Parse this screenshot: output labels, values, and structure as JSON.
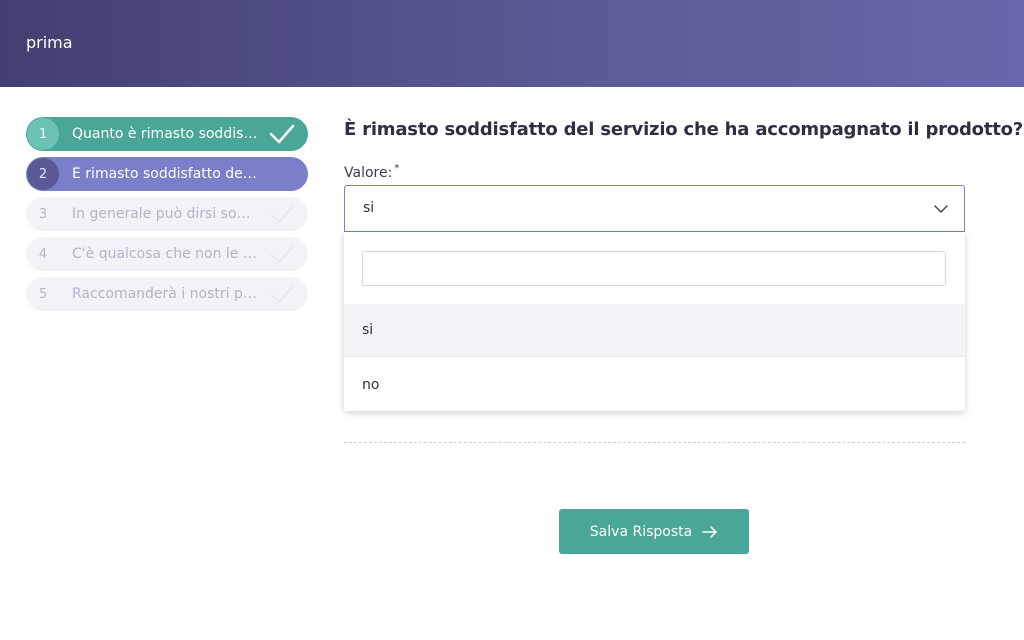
{
  "header": {
    "title": "prima"
  },
  "steps": [
    {
      "number": "1",
      "label": "Quanto è rimasto soddisfa…",
      "state": "done"
    },
    {
      "number": "2",
      "label": "È rimasto soddisfatto del s…",
      "state": "active"
    },
    {
      "number": "3",
      "label": "In generale può dirsi sodd…",
      "state": "pending"
    },
    {
      "number": "4",
      "label": "C'è qualcosa che non le è …",
      "state": "pending"
    },
    {
      "number": "5",
      "label": "Raccomanderà i nostri pro…",
      "state": "pending"
    }
  ],
  "question": {
    "title": "È rimasto soddisfatto del servizio che ha accompagnato il prodotto?"
  },
  "field": {
    "label": "Valore:",
    "required_mark": "*",
    "value": "si",
    "search_placeholder": "",
    "options": [
      "si",
      "no"
    ]
  },
  "actions": {
    "save_label": "Salva Risposta"
  },
  "colors": {
    "accent_green": "#4aa798",
    "accent_purple": "#7b7fc9",
    "header_start": "#423f70",
    "header_end": "#6767ab"
  },
  "icons": {
    "check": "check-icon",
    "chevron": "chevron-down-icon",
    "arrow": "arrow-right-icon"
  }
}
